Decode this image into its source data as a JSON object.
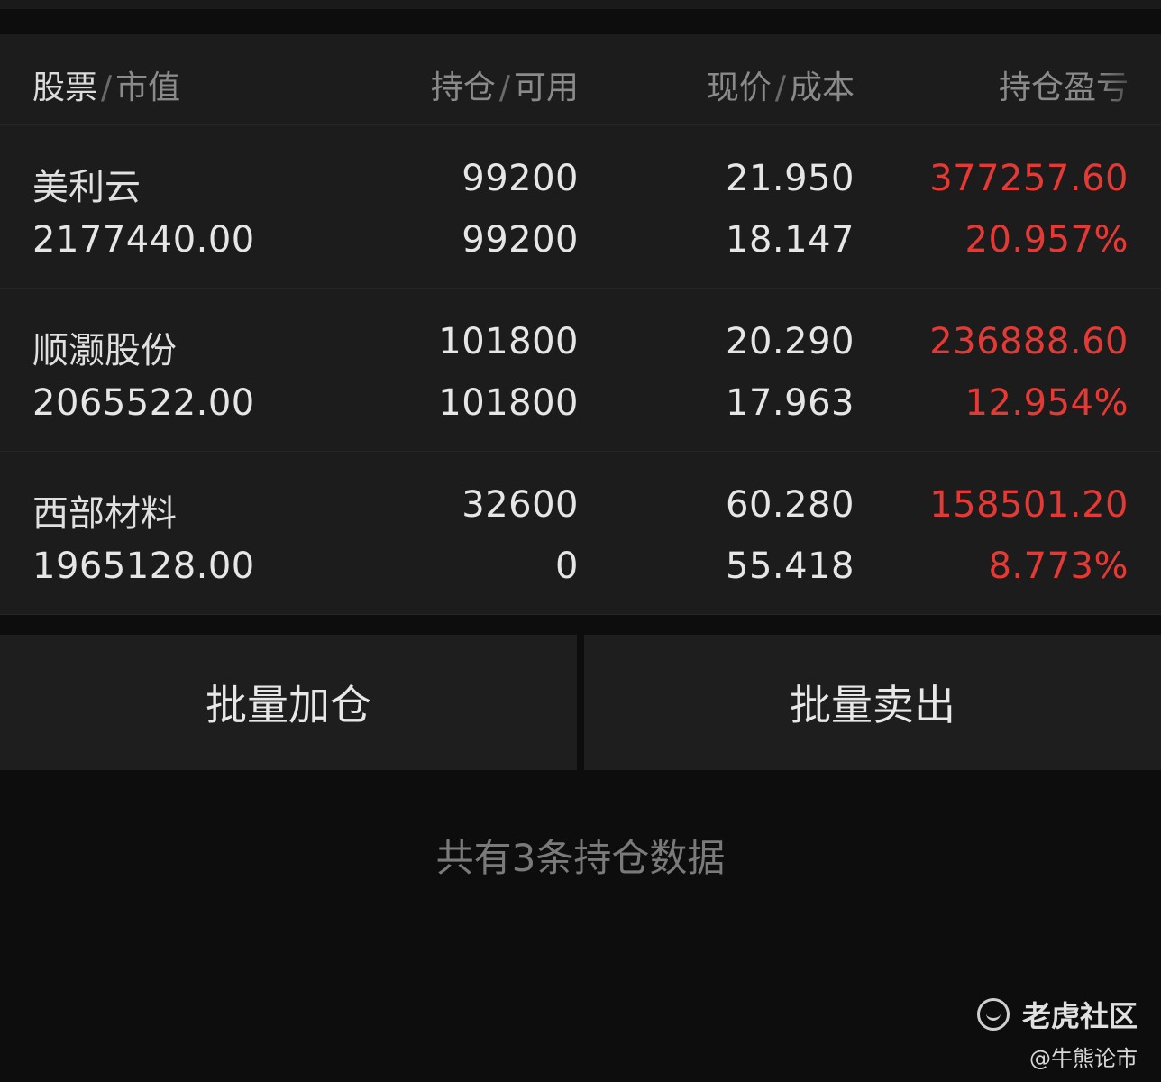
{
  "header": {
    "col1_a": "股票",
    "col1_b": "市值",
    "col2_a": "持仓",
    "col2_b": "可用",
    "col3_a": "现价",
    "col3_b": "成本",
    "col4_a": "持仓盈亏",
    "separator": "/"
  },
  "positions": [
    {
      "name": "美利云",
      "market_value": "2177440.00",
      "holding": "99200",
      "available": "99200",
      "price": "21.950",
      "cost": "18.147",
      "pnl": "377257.60",
      "pnl_pct": "20.957%"
    },
    {
      "name": "顺灏股份",
      "market_value": "2065522.00",
      "holding": "101800",
      "available": "101800",
      "price": "20.290",
      "cost": "17.963",
      "pnl": "236888.60",
      "pnl_pct": "12.954%"
    },
    {
      "name": "西部材料",
      "market_value": "1965128.00",
      "holding": "32600",
      "available": "0",
      "price": "60.280",
      "cost": "55.418",
      "pnl": "158501.20",
      "pnl_pct": "8.773%"
    }
  ],
  "actions": {
    "batch_add": "批量加仓",
    "batch_sell": "批量卖出"
  },
  "summary": "共有3条持仓数据",
  "watermark": {
    "brand": "老虎社区",
    "handle": "@牛熊论市",
    "icon": "tiger-logo-icon"
  },
  "colors": {
    "gain": "#e53935",
    "background": "#0d0d0d",
    "panel": "#1c1c1c"
  }
}
